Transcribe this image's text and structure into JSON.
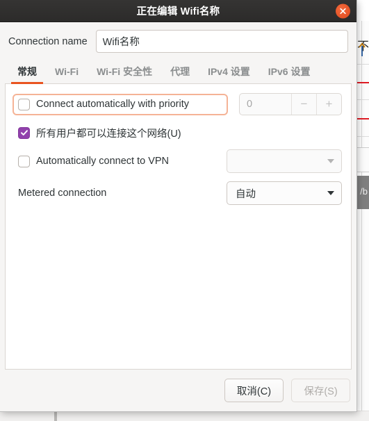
{
  "window": {
    "title": "正在编辑 Wifi名称",
    "close_icon": "close-icon"
  },
  "connection": {
    "label": "Connection name",
    "value": "Wifi名称",
    "placeholder": ""
  },
  "tabs": [
    {
      "label": "常规",
      "active": true
    },
    {
      "label": "Wi-Fi",
      "active": false
    },
    {
      "label": "Wi-Fi 安全性",
      "active": false
    },
    {
      "label": "代理",
      "active": false
    },
    {
      "label": "IPv4 设置",
      "active": false
    },
    {
      "label": "IPv6 设置",
      "active": false
    }
  ],
  "general": {
    "auto_connect": {
      "label": "Connect automatically with priority",
      "checked": false,
      "focused": true
    },
    "priority": {
      "value": "0",
      "decrement_label": "−",
      "increment_label": "+",
      "enabled": false
    },
    "all_users": {
      "label": "所有用户都可以连接这个网络(U)",
      "checked": true
    },
    "auto_vpn": {
      "label": "Automatically connect to VPN",
      "checked": false
    },
    "vpn_combo": {
      "value": "",
      "enabled": false
    },
    "metered": {
      "label": "Metered connection",
      "value": "自动",
      "enabled": true
    }
  },
  "footer": {
    "cancel_label": "取消(C)",
    "save_label": "保存(S)",
    "save_enabled": false
  },
  "background": {
    "cjk_sliver": "不",
    "grey_bar_text": "/b"
  },
  "colors": {
    "accent": "#e95420",
    "titlebar": "#2f2f2d",
    "checkbox_checked": "#9141ac",
    "focus_ring": "#f5b396",
    "red_rule": "#e01b24"
  }
}
